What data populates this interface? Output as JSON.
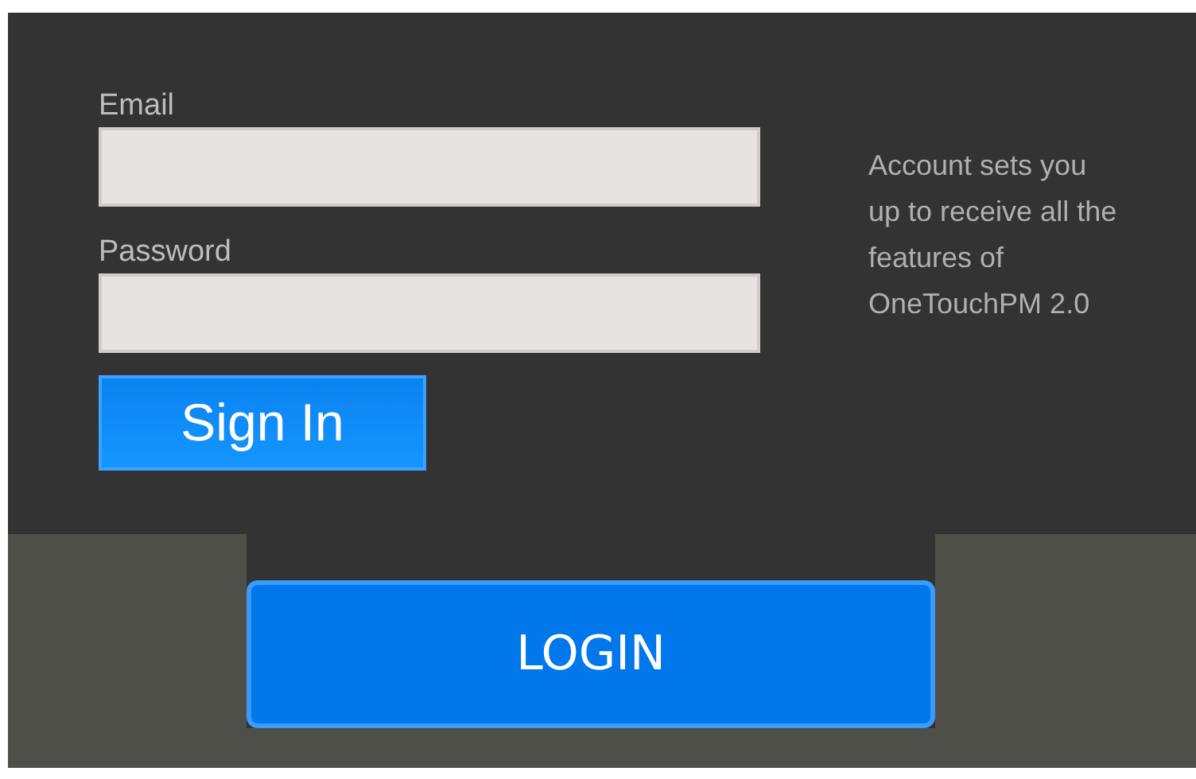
{
  "form": {
    "email": {
      "label": "Email"
    },
    "password": {
      "label": "Password"
    },
    "sign_in": "Sign In"
  },
  "info": "Account sets you up to receive all the features of OneTouchPM 2.0",
  "login_button": "LOGIN"
}
